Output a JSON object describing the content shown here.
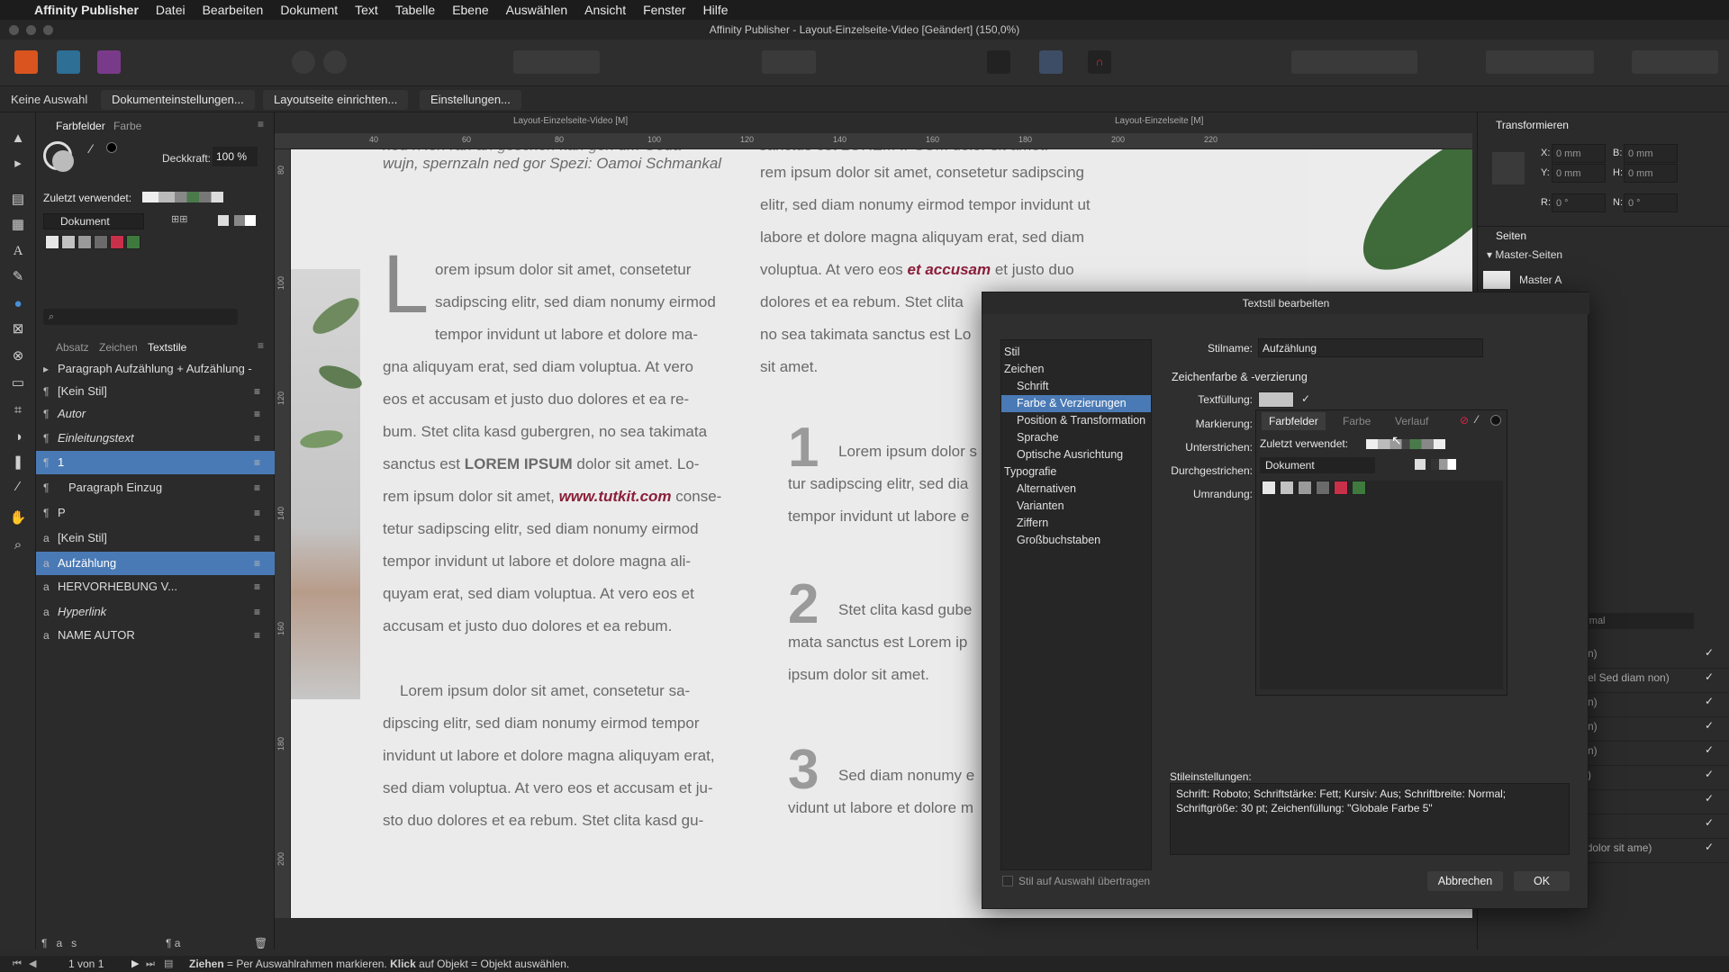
{
  "menubar": {
    "apple": "",
    "app_name": "Affinity Publisher",
    "items": [
      "Datei",
      "Bearbeiten",
      "Dokument",
      "Text",
      "Tabelle",
      "Ebene",
      "Auswählen",
      "Ansicht",
      "Fenster",
      "Hilfe"
    ]
  },
  "window_title": "Affinity Publisher - Layout-Einzelseite-Video [Geändert] (150,0%)",
  "context_bar": {
    "selection": "Keine Auswahl",
    "btn_doc_settings": "Dokumenteinstellungen...",
    "btn_layout_page": "Layoutseite einrichten...",
    "btn_settings": "Einstellungen..."
  },
  "doc_tabs": [
    "Layout-Einzelseite-Video [M]",
    "Layout-Einzelseite [M]"
  ],
  "left_panel": {
    "tab_swatches": "Farbfelder",
    "tab_color": "Farbe",
    "opacity_label": "Deckkraft:",
    "opacity_value": "100 %",
    "recent_label": "Zuletzt verwendet:",
    "palette": "Dokument",
    "style_tabs": [
      "Absatz",
      "Zeichen",
      "Textstile"
    ],
    "group_header": "Paragraph Aufzählung + Aufzählung -",
    "styles": [
      {
        "icon": "¶",
        "name": "[Kein Stil]",
        "italic": false,
        "sel": false
      },
      {
        "icon": "¶",
        "name": "Autor",
        "italic": true,
        "sel": false
      },
      {
        "icon": "¶",
        "name": "Einleitungstext",
        "italic": true,
        "sel": false
      },
      {
        "icon": "¶",
        "name": "1",
        "italic": false,
        "sel": true
      },
      {
        "icon": "¶",
        "name": "Paragraph Einzug",
        "italic": false,
        "sel": false
      },
      {
        "icon": "¶",
        "name": "P",
        "italic": false,
        "sel": false
      },
      {
        "icon": "a",
        "name": "[Kein Stil]",
        "italic": false,
        "sel": false
      },
      {
        "icon": "a",
        "name": "Aufzählung",
        "italic": false,
        "sel": true
      },
      {
        "icon": "a",
        "name": "HERVORHEBUNG V...",
        "italic": false,
        "sel": false
      },
      {
        "icon": "a",
        "name": "Hyperlink",
        "italic": true,
        "sel": false
      },
      {
        "icon": "a",
        "name": "NAME AUTOR",
        "italic": false,
        "sel": false
      }
    ]
  },
  "colors": {
    "accent": "#4a7ab5",
    "highlight_red": "#8a1f3a",
    "swatches": [
      "#e6e6e6",
      "#c2c2c2",
      "#9a9a9a",
      "#6a6a6a",
      "#c8304a",
      "#3e7a3e"
    ]
  },
  "ruler": {
    "h": [
      "40",
      "60",
      "80",
      "100",
      "120",
      "140",
      "160",
      "180",
      "200",
      "220"
    ],
    "v": [
      "80",
      "100",
      "120",
      "140",
      "160",
      "180",
      "200"
    ]
  },
  "page_text": {
    "top_left_1": "ned rHon ran an geschen kan geh um Goda",
    "top_left_2": "wujn, spernzaln ned gor Spezi: Oamoi Schmankal",
    "dropcap": "L",
    "col1": [
      "orem ipsum dolor sit amet, consetetur",
      "sadipscing elitr, sed diam nonumy eirmod",
      "tempor invidunt ut labore et dolore ma-",
      "gna aliquyam erat, sed diam voluptua. At vero",
      "eos et accusam et justo duo dolores et ea re-",
      "bum. Stet clita kasd gubergren, no sea takimata",
      "sanctus est ",
      "rem ipsum dolor sit amet, ",
      "tetur sadipscing elitr, sed diam nonumy eirmod",
      "tempor invidunt ut labore et dolore magna ali-",
      "quyam erat, sed diam voluptua. At vero eos et",
      "accusam et justo duo dolores et ea rebum."
    ],
    "lorem_bold": "LOREM IPSUM",
    "dolor_lo": " dolor sit amet. Lo-",
    "link": "www.tutkit.com",
    "conse": " conse-",
    "col1b": [
      "Lorem ipsum dolor sit amet, consetetur sa-",
      "dipscing elitr, sed diam nonumy eirmod tempor",
      "invidunt ut labore et dolore magna aliquyam erat,",
      "sed diam voluptua. At vero eos et accusam et ju-",
      "sto duo dolores et ea rebum. Stet clita kasd gu-"
    ],
    "col2_top": "sanctus est LOREM IPSUM dolor sit amet.",
    "col2": [
      "rem ipsum dolor sit amet, consetetur sadipscing",
      "elitr, sed diam nonumy eirmod tempor invidunt ut",
      "labore et dolore magna aliquyam erat, sed diam",
      "voluptua. At vero eos ",
      "dolores et ea rebum. Stet clita",
      "no sea takimata sanctus est Lo",
      "sit amet."
    ],
    "accusam": "et accusam",
    "justo": " et justo duo",
    "num1": "1",
    "num2": "2",
    "num3": "3",
    "n1": [
      "Lorem ipsum dolor s",
      "tur sadipscing elitr, sed dia",
      "tempor invidunt ut labore e"
    ],
    "n2": [
      "Stet clita kasd gube",
      "mata sanctus est Lorem ip",
      "ipsum dolor sit amet."
    ],
    "n3": [
      "Sed diam nonumy e",
      "vidunt ut labore et dolore m"
    ]
  },
  "right_panel": {
    "transform_title": "Transformieren",
    "x_label": "X:",
    "x_val": "0 mm",
    "y_label": "Y:",
    "y_val": "0 mm",
    "w_label": "B:",
    "w_val": "0 mm",
    "h_label": "H:",
    "h_val": "0 mm",
    "r_label": "R:",
    "r_val": "0 °",
    "s_label": "N:",
    "s_val": "0 °",
    "pages_title": "Seiten",
    "master_header": "Master-Seiten",
    "master_a": "Master A",
    "blend_mode": "ormal",
    "layers": [
      "n)",
      "el Sed diam non)",
      "n)",
      "n)",
      "n)",
      ")",
      "",
      "",
      "(Lorem ipsum dolor sit ame)"
    ]
  },
  "dialog": {
    "title": "Textstil bearbeiten",
    "categories": [
      {
        "label": "Stil",
        "sub": false,
        "sel": false
      },
      {
        "label": "Zeichen",
        "sub": false,
        "sel": false
      },
      {
        "label": "Schrift",
        "sub": true,
        "sel": false
      },
      {
        "label": "Farbe & Verzierungen",
        "sub": true,
        "sel": true
      },
      {
        "label": "Position & Transformation",
        "sub": true,
        "sel": false
      },
      {
        "label": "Sprache",
        "sub": true,
        "sel": false
      },
      {
        "label": "Optische Ausrichtung",
        "sub": true,
        "sel": false
      },
      {
        "label": "Typografie",
        "sub": false,
        "sel": false
      },
      {
        "label": "Alternativen",
        "sub": true,
        "sel": false
      },
      {
        "label": "Varianten",
        "sub": true,
        "sel": false
      },
      {
        "label": "Ziffern",
        "sub": true,
        "sel": false
      },
      {
        "label": "Großbuchstaben",
        "sub": true,
        "sel": false
      }
    ],
    "style_name_label": "Stilname:",
    "style_name_value": "Aufzählung",
    "section_title": "Zeichenfarbe & -verzierung",
    "fill_label": "Textfüllung:",
    "mark_label": "Markierung:",
    "underline_label": "Unterstrichen:",
    "strike_label": "Durchgestrichen:",
    "outline_label": "Umrandung:",
    "popup_tabs": [
      "Farbfelder",
      "Farbe",
      "Verlauf"
    ],
    "recent_label": "Zuletzt verwendet:",
    "palette": "Dokument",
    "settings_label": "Stileinstellungen:",
    "settings_line1": "Schrift: Roboto; Schriftstärke: Fett; Kursiv: Aus; Schriftbreite: Normal;",
    "settings_line2": "Schriftgröße: 30 pt; Zeichenfüllung: \"Globale Farbe 5\"",
    "apply_label": "Stil auf Auswahl übertragen",
    "cancel": "Abbrechen",
    "ok": "OK"
  },
  "status": {
    "page": "1 von 1",
    "hint_b1": "Ziehen",
    "hint_1": " = Per Auswahlrahmen markieren. ",
    "hint_b2": "Klick",
    "hint_2": " auf Objekt = Objekt auswählen."
  }
}
